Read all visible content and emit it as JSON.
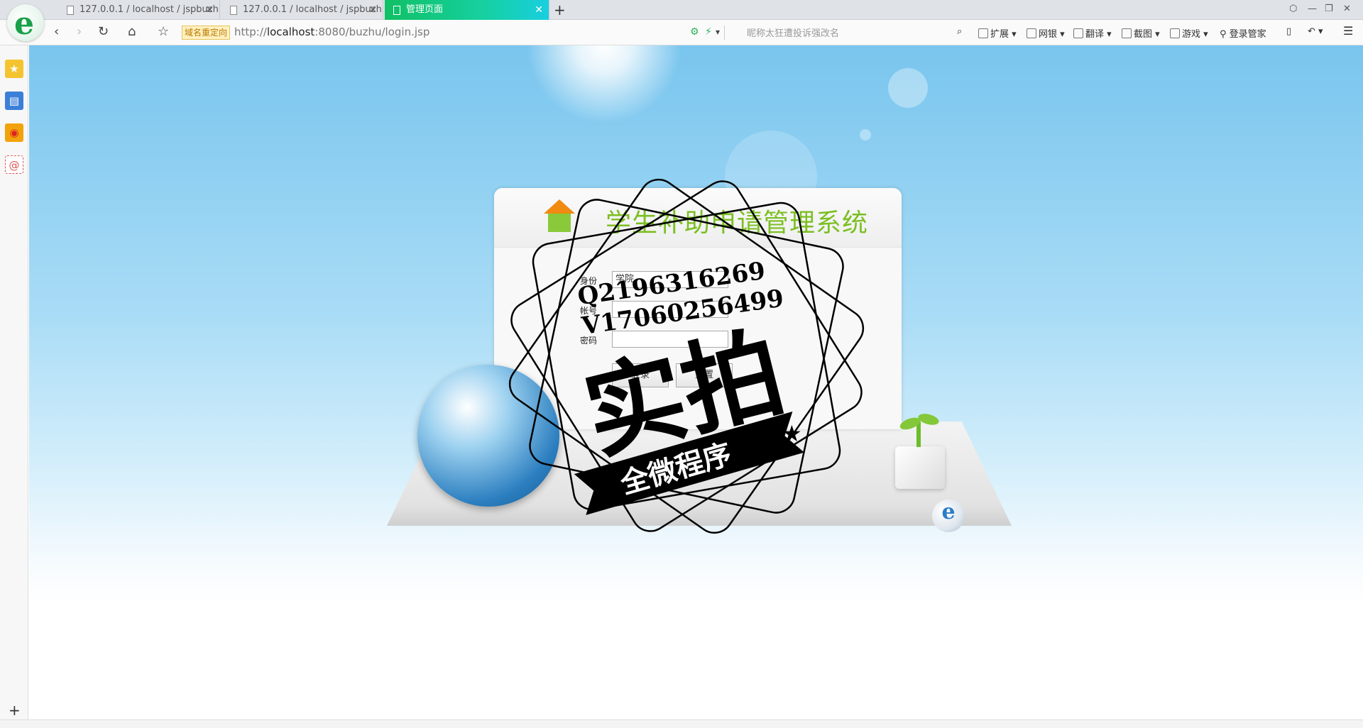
{
  "browser": {
    "tabs": [
      {
        "label": "127.0.0.1 / localhost / jspbuzhu"
      },
      {
        "label": "127.0.0.1 / localhost / jspbuzhu"
      },
      {
        "label": "管理页面"
      }
    ],
    "redirect_badge": "域名重定向",
    "url_prefix": "http://",
    "url_host": "localhost",
    "url_rest": ":8080/buzhu/login.jsp",
    "search_placeholder": "昵称太狂遭投诉强改名",
    "tools": {
      "extend": "扩展",
      "netbank": "网银",
      "translate": "翻译",
      "screenshot": "截图",
      "games": "游戏",
      "login_manager": "登录管家"
    }
  },
  "page": {
    "system_title": "学生补助申请管理系统",
    "form": {
      "identity_label": "身份",
      "identity_value": "学院",
      "account_label": "帐号",
      "password_label": "密码",
      "login_button": "登录",
      "reset_button": "重置"
    }
  },
  "watermark": {
    "qq": "Q2196316269",
    "vx": "V17060256499",
    "big_text": "实拍",
    "banner_text": "全微程序"
  },
  "colors": {
    "active_tab": "#10c064",
    "title_green": "#7cbf22",
    "sky": "#79c5ee"
  }
}
